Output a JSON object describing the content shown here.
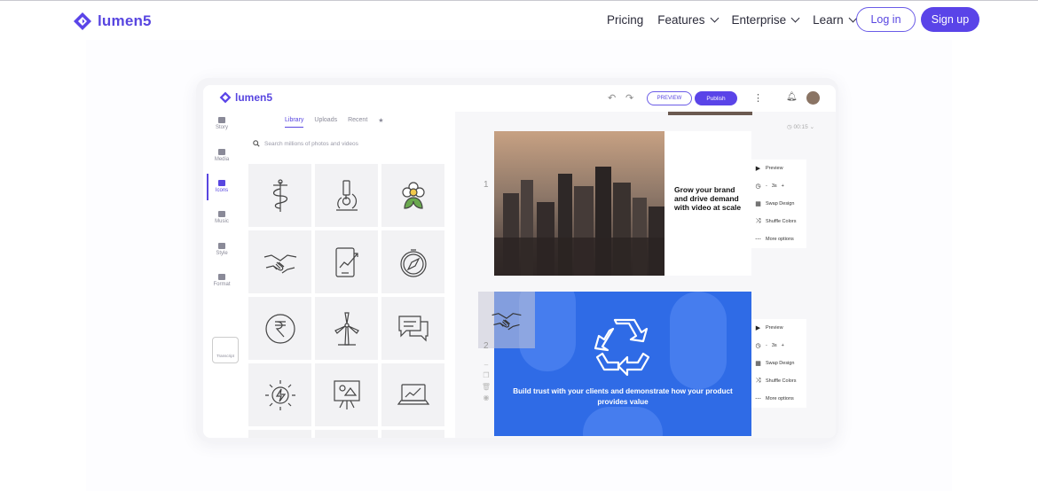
{
  "nav": {
    "logo_text": "lumen5",
    "links": [
      "Pricing",
      "Features",
      "Enterprise",
      "Learn"
    ],
    "login_label": "Log in",
    "signup_label": "Sign up",
    "brand_color": "#5a44e8"
  },
  "app": {
    "logo_text": "lumen5",
    "preview_label": "PREVIEW",
    "publish_label": "Publish",
    "sidebar": [
      "Story",
      "Media",
      "Icons",
      "Music",
      "Style",
      "Format"
    ],
    "transcript_label": "Transcript",
    "tabs": [
      "Library",
      "Uploads",
      "Recent",
      "★"
    ],
    "search_placeholder": "Search millions of photos and videos",
    "timer": "00:15",
    "scenes": [
      {
        "number": "1",
        "text": "Grow your brand and drive demand with video at scale"
      },
      {
        "number": "2",
        "text": "Build trust with your clients and demonstrate how your product provides value"
      }
    ],
    "scene_menu": {
      "preview": "Preview",
      "duration": "3s",
      "swap": "Swap Design",
      "shuffle": "Shuffle Colors",
      "more": "More options"
    },
    "icons": [
      "caduceus-icon",
      "microscope-icon",
      "flower-icon",
      "handshake-icon",
      "growth-chart-icon",
      "compass-icon",
      "rupee-coin-icon",
      "wind-turbine-icon",
      "chat-bubbles-icon",
      "energy-bolt-icon",
      "presentation-board-icon",
      "laptop-chart-icon"
    ]
  }
}
